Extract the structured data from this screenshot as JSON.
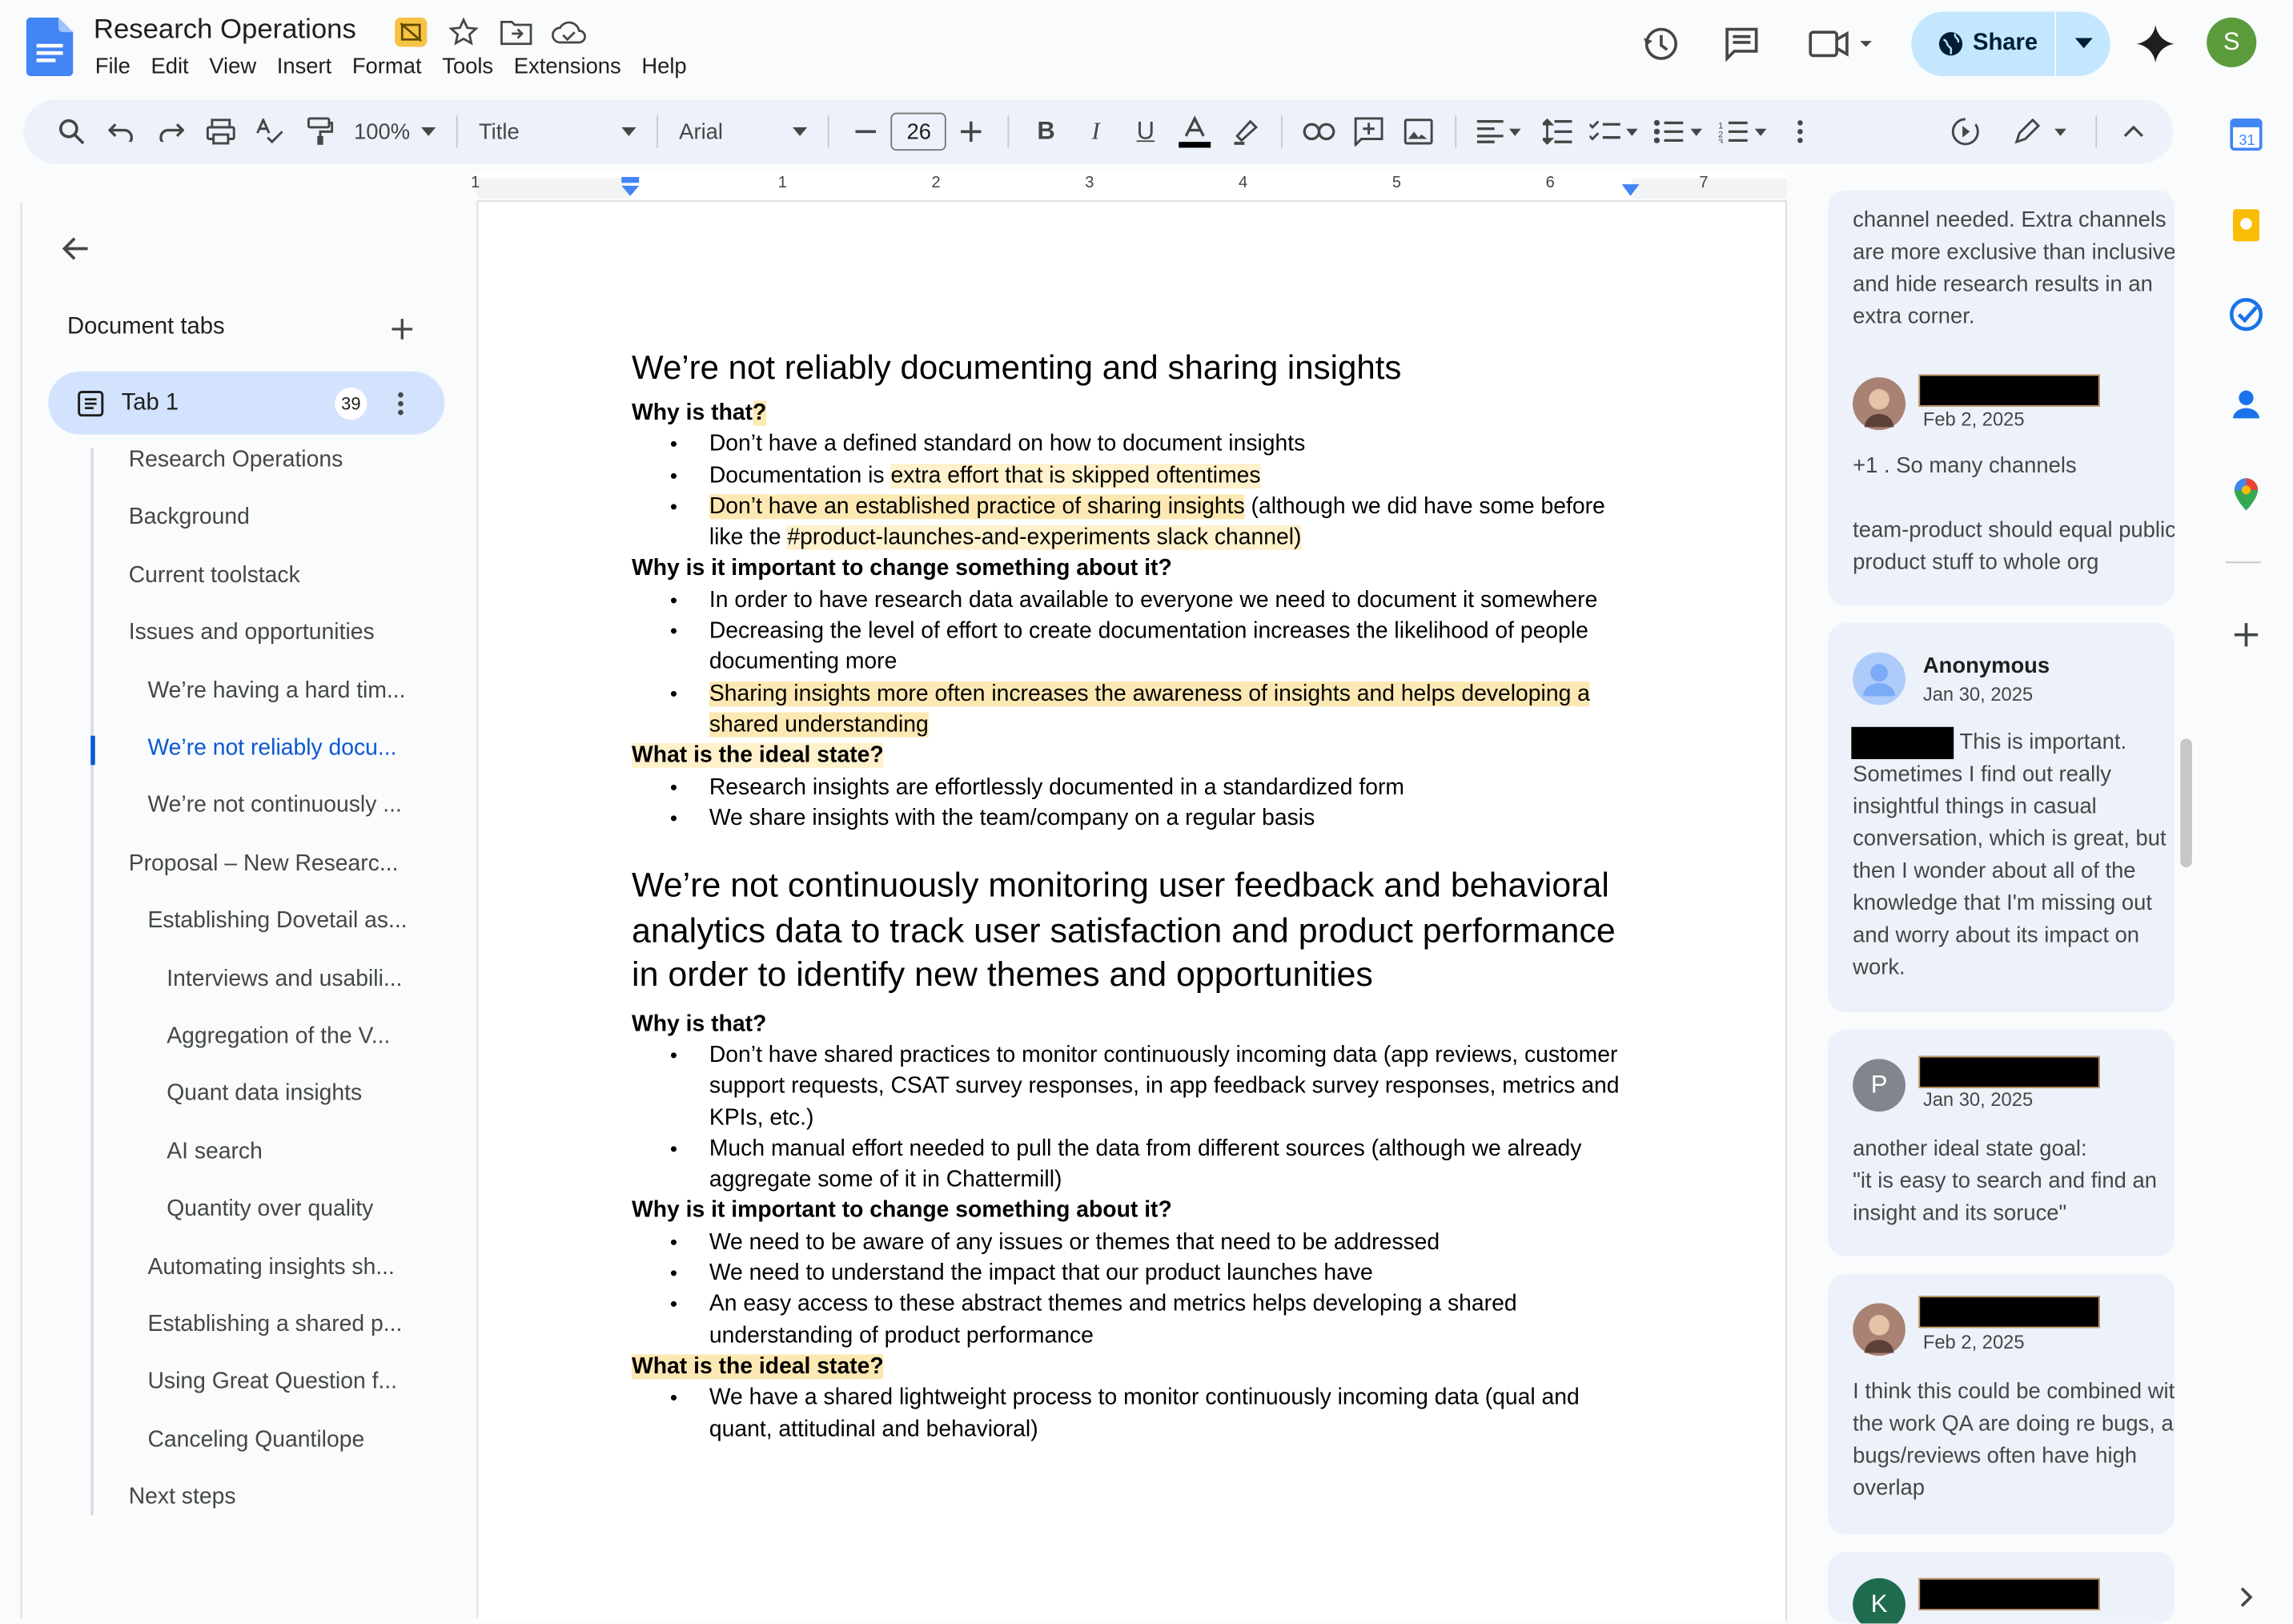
{
  "app": {
    "title": "Research Operations"
  },
  "menu": [
    "File",
    "Edit",
    "View",
    "Insert",
    "Format",
    "Tools",
    "Extensions",
    "Help"
  ],
  "share": {
    "label": "Share"
  },
  "user": {
    "initial": "S"
  },
  "toolbar": {
    "zoom": "100%",
    "style": "Title",
    "font": "Arial",
    "font_size": "26"
  },
  "ruler": [
    "1",
    "1",
    "2",
    "3",
    "4",
    "5",
    "6",
    "7"
  ],
  "left_panel": {
    "header": "Document tabs",
    "tab": {
      "label": "Tab 1",
      "badge": "39"
    },
    "outline": [
      {
        "label": "Research Operations",
        "level": 1
      },
      {
        "label": "Background",
        "level": 1
      },
      {
        "label": "Current toolstack",
        "level": 1
      },
      {
        "label": "Issues and opportunities",
        "level": 1
      },
      {
        "label": "We’re having a hard tim...",
        "level": 2
      },
      {
        "label": "We’re not reliably docu...",
        "level": 2,
        "active": true
      },
      {
        "label": "We’re not continuously ...",
        "level": 2
      },
      {
        "label": "Proposal – New Researc...",
        "level": 1
      },
      {
        "label": "Establishing Dovetail as...",
        "level": 2
      },
      {
        "label": "Interviews and usabili...",
        "level": 3
      },
      {
        "label": "Aggregation of the V...",
        "level": 3
      },
      {
        "label": "Quant data insights",
        "level": 3
      },
      {
        "label": "AI search",
        "level": 3
      },
      {
        "label": "Quantity over quality",
        "level": 3
      },
      {
        "label": "Automating insights sh...",
        "level": 2
      },
      {
        "label": "Establishing a shared p...",
        "level": 2
      },
      {
        "label": "Using Great Question f...",
        "level": 2
      },
      {
        "label": "Canceling Quantilope",
        "level": 2
      },
      {
        "label": "Next steps",
        "level": 1
      }
    ]
  },
  "doc": {
    "h1": "We’re not reliably documenting and sharing insights",
    "q1": "Why is that",
    "q1_mark": "?",
    "s1_b1": "Don’t have a defined standard on how to document insights",
    "s1_b2a": "Documentation is ",
    "s1_b2b": "extra effort that is skipped oftentimes",
    "s1_b3a": "Don’t have an established practice of sharing insights",
    "s1_b3b": " (although we did have some before like the ",
    "s1_b3c": "#product-launches-and-experiments slack channel)",
    "q2": "Why is it important to change something about it?",
    "s1_b4": "In order to have research data available to everyone we need to document it somewhere",
    "s1_b5": "Decreasing the level of effort to create documentation increases the likelihood of people documenting more",
    "s1_b6": "Sharing insights more often increases the awareness of insights and helps developing a shared understanding",
    "q3": "What is the ideal state?",
    "s1_b7": "Research insights are effortlessly documented in a standardized form",
    "s1_b8": "We share insights with the team/company on a regular basis",
    "h2": "We’re not continuously monitoring user feedback and behavioral analytics data to track user satisfaction and product performance in order to identify new themes and opportunities",
    "q4": "Why is that?",
    "s2_b1": "Don’t have shared practices to monitor continuously incoming data (app reviews, customer support requests, CSAT survey responses, in app feedback survey responses, metrics and KPIs, etc.)",
    "s2_b2": "Much manual effort needed to pull the data from different sources (although we already aggregate some of it in Chattermill)",
    "q5": "Why is it important to change something about it?",
    "s2_b3": "We need to be aware of any issues or themes that need to be addressed",
    "s2_b4": "We need to understand the impact that our product launches have",
    "s2_b5": "An easy access to these abstract themes and metrics helps developing a shared understanding of product performance",
    "q6": "What is the ideal state?",
    "s2_b6": "We have a shared lightweight process to monitor continuously incoming data (qual and quant, attitudinal and behavioral)"
  },
  "comments": [
    {
      "text": "channel needed. Extra channels are more exclusive than inclusive and hide research results in an extra corner."
    },
    {
      "date": "Feb 2, 2025",
      "text": "+1 . So many channels\n\nteam-product should equal public product stuff to whole org"
    },
    {
      "name": "Anonymous",
      "date": "Jan 30, 2025",
      "text": "This is important. Sometimes I find out really insightful things in casual conversation, which is great, but then I wonder about all of the knowledge that I'm missing out and worry about its impact on work."
    },
    {
      "initial": "P",
      "date": "Jan 30, 2025",
      "text": "another ideal state goal:\n\"it is easy to search and find an insight and its soruce\""
    },
    {
      "date": "Feb 2, 2025",
      "text": "I think this could be combined with the work QA are doing re bugs, as bugs/reviews often have high overlap"
    },
    {
      "initial": "K"
    }
  ],
  "colors": {
    "accent": "#0b57d0",
    "share_bg": "#c2e7ff",
    "tab_bg": "#d3e3fd",
    "highlight": "#fce8b2"
  }
}
